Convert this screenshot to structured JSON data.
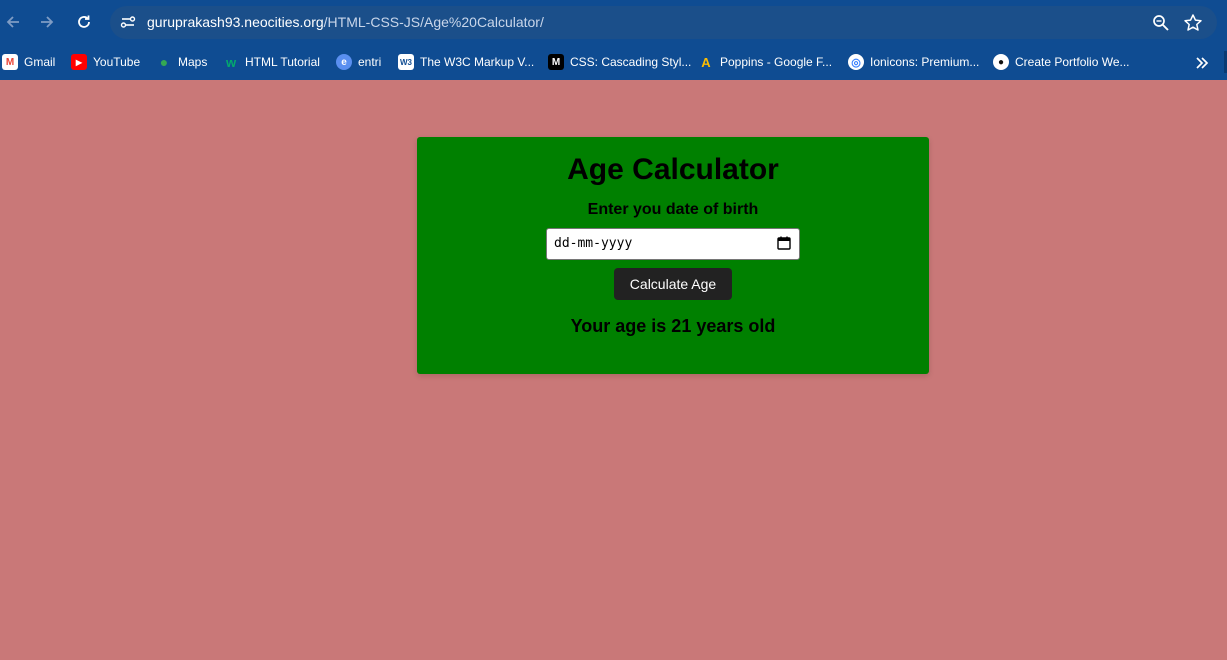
{
  "browser": {
    "url_host": "guruprakash93.neocities.org",
    "url_path": "/HTML-CSS-JS/Age%20Calculator/",
    "bookmarks": [
      {
        "label": "Gmail",
        "icon": "gmail-icon"
      },
      {
        "label": "YouTube",
        "icon": "youtube-icon"
      },
      {
        "label": "Maps",
        "icon": "maps-icon"
      },
      {
        "label": "HTML Tutorial",
        "icon": "w3schools-icon"
      },
      {
        "label": "entri",
        "icon": "entri-icon"
      },
      {
        "label": "The W3C Markup V...",
        "icon": "w3c-icon"
      },
      {
        "label": "CSS: Cascading Styl...",
        "icon": "mdn-icon"
      },
      {
        "label": "Poppins - Google F...",
        "icon": "google-fonts-icon"
      },
      {
        "label": "Ionicons: Premium...",
        "icon": "ionicons-icon"
      },
      {
        "label": "Create Portfolio We...",
        "icon": "portfolio-icon"
      }
    ]
  },
  "app": {
    "title": "Age Calculator",
    "dob_label": "Enter you date of birth",
    "dob_placeholder": "dd-mm-yyyy",
    "button_label": "Calculate Age",
    "result": "Your age is 21 years old"
  },
  "colors": {
    "page_bg": "#c97878",
    "card_bg": "#008000",
    "button_bg": "#222222",
    "chrome_bg": "#0f4c92"
  }
}
